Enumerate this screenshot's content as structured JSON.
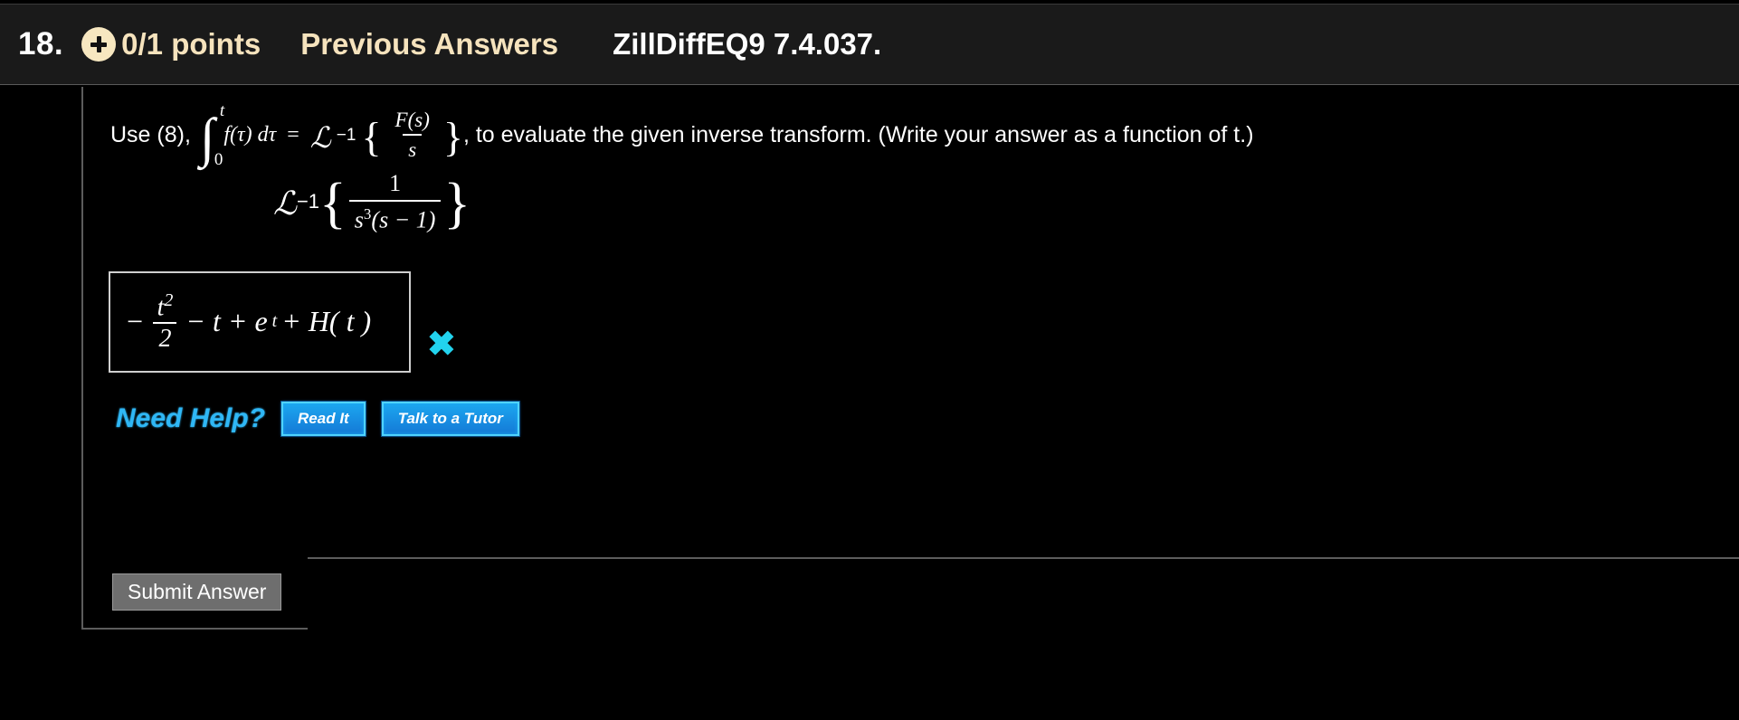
{
  "header": {
    "question_number": "18.",
    "badge_icon": "plus-icon",
    "points": "0/1 points",
    "previous_answers": "Previous Answers",
    "reference": "ZillDiffEQ9 7.4.037.",
    "badge_color": "#f7e7c0",
    "text_color": "#f6e3bd"
  },
  "problem": {
    "lead": "Use (8),",
    "integral": {
      "upper_limit": "t",
      "lower_limit": "0",
      "symbol": "∫",
      "integrand": "f(τ) dτ"
    },
    "equals": "=",
    "laplace_symbol": "ℒ",
    "laplace_exponent": "−1",
    "brace_open": "{",
    "brace_close": "}",
    "fraction_numerator": "F(s)",
    "fraction_denominator": "s",
    "tail": ", to evaluate the given inverse transform. (Write your answer as a function of t.)"
  },
  "expression": {
    "laplace_symbol": "ℒ",
    "laplace_exponent": "−1",
    "brace_open": "{",
    "brace_close": "}",
    "numerator": "1",
    "denominator_base": "s",
    "denominator_exponent": "3",
    "denominator_rest": "(s − 1)"
  },
  "answer": {
    "minus": "−",
    "frac_num": "t",
    "frac_num_exp": "2",
    "frac_den": "2",
    "rest": "− t + e",
    "rest_exp": "t",
    "tail": "+ H( t )",
    "status_icon": "x-mark-incorrect",
    "status_symbol": "✖",
    "status_color": "#22d3ee"
  },
  "help": {
    "label": "Need Help?",
    "read_it": "Read It",
    "talk_to_tutor": "Talk to a Tutor",
    "accent_color": "#2fb7f5"
  },
  "footer": {
    "submit_label": "Submit Answer",
    "submit_bg": "#6e6e6e"
  }
}
